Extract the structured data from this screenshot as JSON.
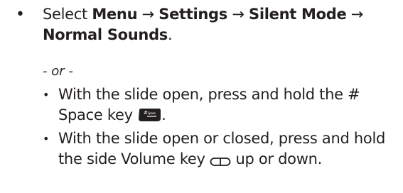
{
  "step": {
    "prefix": "Select ",
    "menu": "Menu",
    "arrow1": " → ",
    "settings": "Settings",
    "arrow2": " → ",
    "silent_mode": "Silent Mode",
    "arrow3": " → ",
    "normal_sounds": "Normal Sounds",
    "suffix": "."
  },
  "or_text": "- or -",
  "options": [
    {
      "text_before": "With the slide open, press and hold the # Space key",
      "icon": "space-key-icon",
      "text_after": "."
    },
    {
      "text_before": "With the slide open or closed, press and hold the side Volume key",
      "icon": "volume-key-icon",
      "text_after": "up or down."
    }
  ],
  "icon_labels": {
    "space_key_top": "#",
    "space_key_bottom": "Space"
  }
}
